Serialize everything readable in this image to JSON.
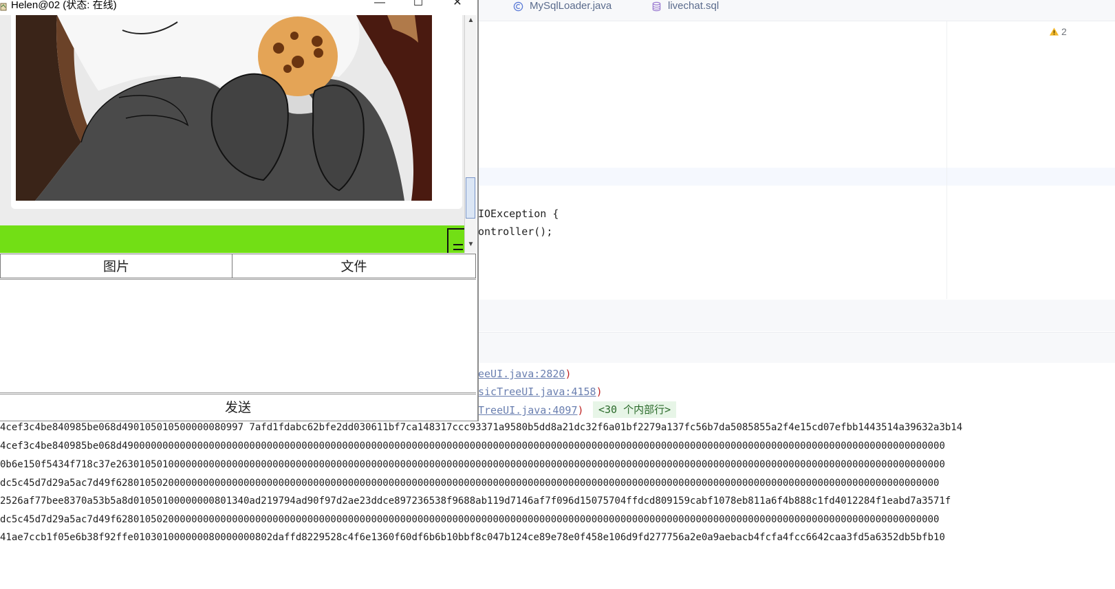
{
  "ide": {
    "tabs": [
      {
        "label": "MySqlLoader.java",
        "icon": "java-class-icon"
      },
      {
        "label": "livechat.sql",
        "icon": "database-icon"
      }
    ],
    "warning_count": "2",
    "code_lines": [
      "IOException {",
      "ontroller();"
    ],
    "stack_trace": [
      {
        "link": "eeUI.java:2820",
        "close": ")"
      },
      {
        "link": "sicTreeUI.java:4158",
        "close": ")"
      },
      {
        "link": "TreeUI.java:4097",
        "close": ")"
      }
    ],
    "internal_lines_badge": "<30 个内部行>",
    "hex_lines": [
      "4cef3c4be840985be068d490105010500000080997 7afd1fdabc62bfe2dd030611bf7ca148317ccc93371a9580b5dd8a21dc32f6a01bf2279a137fc56b7da5085855a2f4e15cd07efbb1443514a39632a3b14",
      "4cef3c4be840985be068d4900000000000000000000000000000000000000000000000000000000000000000000000000000000000000000000000000000000000000000000000000000000000000000000",
      "0b6e150f5434f718c37e26301050100000000000000000000000000000000000000000000000000000000000000000000000000000000000000000000000000000000000000000000000000000000000000",
      "dc5c45d7d29a5ac7d49f6280105020000000000000000000000000000000000000000000000000000000000000000000000000000000000000000000000000000000000000000000000000000000000000",
      "2526af77bee8370a53b5a8d01050100000000801340ad219794ad90f97d2ae23ddce897236538f9688ab119d7146af7f096d15075704ffdcd809159cabf1078eb811a6f4b888c1fd4012284f1eabd7a3571f",
      "dc5c45d7d29a5ac7d49f6280105020000000000000000000000000000000000000000000000000000000000000000000000000000000000000000000000000000000000000000000000000000000000000",
      "41ae7ccb1f05e6b38f92ffe010301000000080000000802daffd8229528c4f6e1360f60df6b6b10bbf8c047b124ce89e78e0f458e106d9fd277756a2e0a9aebacb4fcfa4fcc6642caa3fd5a6352db5bfb10"
    ]
  },
  "chat": {
    "title": "Helen@02 (状态: 在线)",
    "minimize": "—",
    "maximize": "☐",
    "close": "✕",
    "image_button": "图片",
    "file_button": "文件",
    "send_button": "发送",
    "input_value": ""
  },
  "colors": {
    "green_bar": "#72df15",
    "link": "#6a7fb0"
  }
}
